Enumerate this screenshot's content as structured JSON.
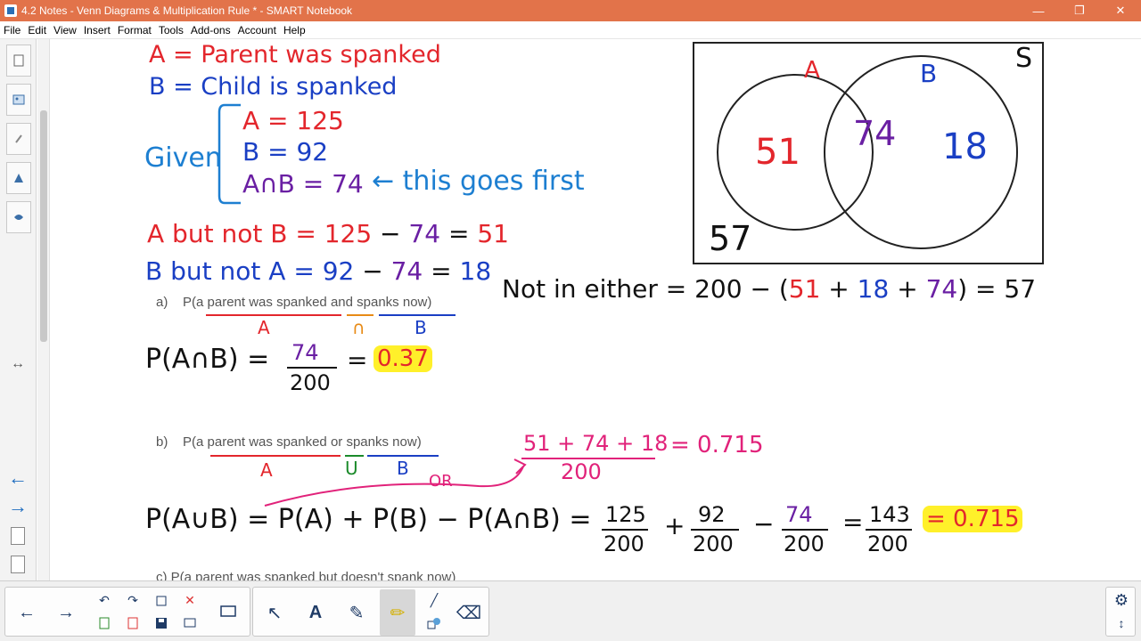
{
  "window": {
    "title": "4.2 Notes - Venn Diagrams & Multiplication Rule * - SMART Notebook",
    "minimize": "—",
    "restore": "❐",
    "close": "✕"
  },
  "menu": [
    "File",
    "Edit",
    "View",
    "Insert",
    "Format",
    "Tools",
    "Add-ons",
    "Account",
    "Help"
  ],
  "sidebar": {
    "tabs": [
      "page-sorter",
      "gallery",
      "attachments",
      "properties",
      "addons"
    ],
    "resize_glyph": "↔",
    "prev_glyph": "←",
    "next_glyph": "→"
  },
  "notes": {
    "defA": "A = Parent was spanked",
    "defB": "B = Child is spanked",
    "given": "Given",
    "givenA": "A = 125",
    "givenB": "B = 92",
    "givenAB": "A∩B = 74",
    "arrow_note": "← this goes first",
    "aNotB": {
      "left": "A but not B = ",
      "v1": "125",
      "minus": " − ",
      "v2": "74",
      "eq": " = ",
      "res": "51"
    },
    "bNotA": {
      "left": "B but not A = ",
      "v1": "92",
      "minus": " − ",
      "v2": "74",
      "eq": " = ",
      "res": "18"
    },
    "notEither": {
      "label": "Not in either = 200 − (",
      "n51": "51",
      "p1": " + ",
      "n18": "18",
      "p2": " + ",
      "n74": "74",
      "tail": ") = 57"
    },
    "qa": {
      "label": "a)",
      "text_pre": "P(",
      "text_a": "a parent was spanked",
      "text_and": "and",
      "text_b": "spanks now",
      "text_post": ")",
      "under_a": "A",
      "under_and": "∩",
      "under_b": "B"
    },
    "pAB": {
      "lhs": "P(A∩B) =",
      "num": "74",
      "den": "200",
      "eq": "=",
      "ans": "0.37"
    },
    "qb": {
      "label": "b)",
      "text_pre": "P(",
      "text_a": "a parent was spanked",
      "text_or": "or",
      "text_b": "spanks now",
      "text_post": ")",
      "under_a": "A",
      "under_or": "U",
      "under_b": "B",
      "or_label": "OR"
    },
    "alt": {
      "num": "51 + 74 + 18",
      "den": "200",
      "eq": "= 0.715"
    },
    "pAuB": {
      "lhs": "P(A∪B) = P(A) + P(B) − P(A∩B) =",
      "f1n": "125",
      "f1d": "200",
      "plus": "+",
      "f2n": "92",
      "f2d": "200",
      "minus": "−",
      "f3n": "74",
      "f3d": "200",
      "eq": "=",
      "f4n": "143",
      "f4d": "200",
      "ans": "= 0.715"
    },
    "qc": "c)   P(a parent was spanked but doesn't spank now)"
  },
  "venn": {
    "label_S": "S",
    "label_A": "A",
    "label_B": "B",
    "only_A": "51",
    "both": "74",
    "only_B": "18",
    "neither": "57"
  },
  "toolbar": {
    "back": "←",
    "forward": "→",
    "undo": "↶",
    "redo": "↷",
    "select": "↖",
    "text": "A",
    "pen": "✎",
    "highlighter": "✏",
    "line": "╱",
    "eraser": "⌫",
    "settings": "⚙",
    "resize": "↕"
  },
  "colors": {
    "titlebar": "#e2734a",
    "red": "#e3262c",
    "blue": "#1a3fc4",
    "purple": "#6a1fa3",
    "pink": "#e1227a",
    "highlight": "#fff02a"
  }
}
